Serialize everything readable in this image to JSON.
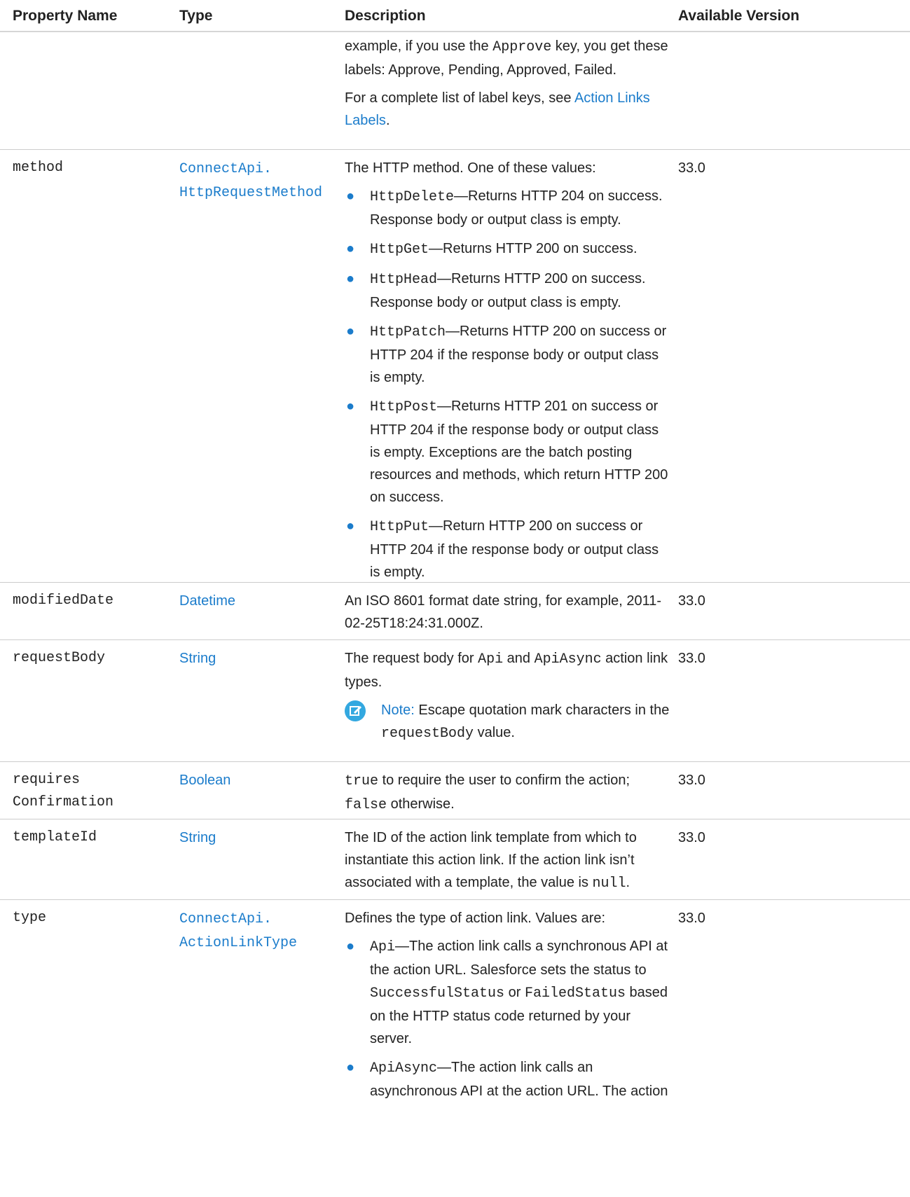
{
  "header": {
    "property_name": "Property Name",
    "type": "Type",
    "description": "Description",
    "available_version": "Available Version"
  },
  "top_continuation": {
    "line1_pre": "example, if you use the ",
    "line1_code": "Approve",
    "line1_post": " key, you get these labels: Approve, Pending, Approved, Failed.",
    "para2_pre": "For a complete list of label keys, see ",
    "para2_link": "Action Links Labels",
    "para2_post": "."
  },
  "rows": {
    "method": {
      "name": "method",
      "type_link": "ConnectApi. HttpRequestMethod",
      "intro": "The HTTP method. One of these values:",
      "version": "33.0",
      "items": [
        {
          "code": "HttpDelete",
          "text": "—Returns HTTP 204 on success. Response body or output class is empty."
        },
        {
          "code": "HttpGet",
          "text": "—Returns HTTP 200 on success."
        },
        {
          "code": "HttpHead",
          "text": "—Returns HTTP 200 on success. Response body or output class is empty."
        },
        {
          "code": "HttpPatch",
          "text": "—Returns HTTP 200 on success or HTTP 204 if the response body or output class is empty."
        },
        {
          "code": "HttpPost",
          "text": "—Returns HTTP 201 on success or HTTP 204 if the response body or output class is empty. Exceptions are the batch posting resources and methods, which return HTTP 200 on success."
        },
        {
          "code": "HttpPut",
          "text": "—Return HTTP 200 on success or HTTP 204 if the response body or output class is empty."
        }
      ]
    },
    "modified_date": {
      "name": "modifiedDate",
      "type_link": "Datetime",
      "desc": "An ISO 8601 format date string, for example, 2011-02-25T18:24:31.000Z.",
      "version": "33.0"
    },
    "request_body": {
      "name": "requestBody",
      "type_link": "String",
      "desc_pre": "The request body for ",
      "desc_code1": "Api",
      "desc_mid": " and ",
      "desc_code2": "ApiAsync",
      "desc_post": " action link types.",
      "note_label": "Note:",
      "note_pre": " Escape quotation mark characters in the ",
      "note_code": "requestBody",
      "note_post": " value.",
      "version": "33.0"
    },
    "requires_confirmation": {
      "name_line1": "requires",
      "name_line2": "Confirmation",
      "type_link": "Boolean",
      "desc_code1": "true",
      "desc_mid": " to require the user to confirm the action; ",
      "desc_code2": "false",
      "desc_post": " otherwise.",
      "version": "33.0"
    },
    "template_id": {
      "name": "templateId",
      "type_link": "String",
      "desc_pre": "The ID of the action link template from which to instantiate this action link. If the action link isn’t associated with a template, the value is ",
      "desc_code": "null",
      "desc_post": ".",
      "version": "33.0"
    },
    "type": {
      "name": "type",
      "type_link": "ConnectApi. ActionLinkType",
      "intro": "Defines the type of action link. Values are:",
      "version": "33.0",
      "item1_code": "Api",
      "item1_pre": "—The action link calls a synchronous API at the action URL. Salesforce sets the status to ",
      "item1_code2": "SuccessfulStatus",
      "item1_mid": " or ",
      "item1_code3": "FailedStatus",
      "item1_post": " based on the HTTP status code returned by your server.",
      "item2_code": "ApiAsync",
      "item2_text": "—The action link calls an asynchronous API at the action URL. The action"
    }
  },
  "colors": {
    "link": "#1b7ccb",
    "bullet": "#1b7ccb",
    "note_icon": "#33a8e0",
    "rule": "#cccccc"
  },
  "icons": {
    "note": "note-edit-icon"
  }
}
